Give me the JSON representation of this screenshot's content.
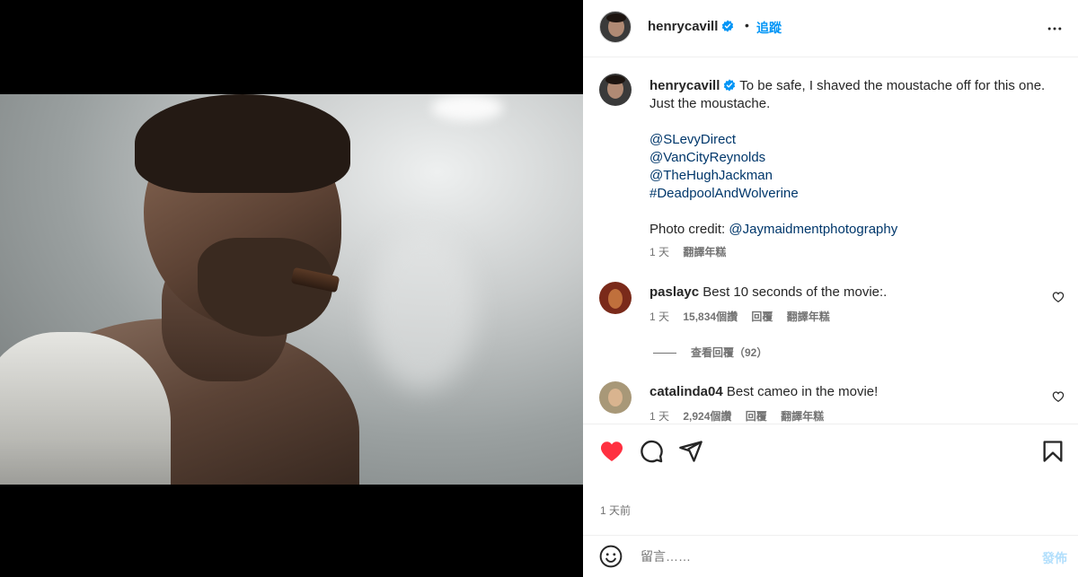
{
  "post": {
    "media": {
      "alt": "",
      "type": "photo"
    },
    "header": {
      "username": "henrycavill",
      "verified_icon": "verified-badge-icon",
      "separator": "•",
      "follow_label": "追蹤",
      "more_icon": "more-options-icon"
    },
    "caption": {
      "username": "henrycavill",
      "text": "To be safe, I shaved the moustache off for this one. Just the moustache.",
      "mentions": [
        "@SLevyDirect",
        "@VanCityReynolds",
        "@TheHughJackman",
        "#DeadpoolAndWolverine"
      ],
      "credit_prefix": "Photo credit: ",
      "credit_link": "@Jaymaidmentphotography",
      "time": "1 天",
      "translate": "翻譯年糕"
    },
    "comments": [
      {
        "username": "paslayc",
        "text": "Best 10 seconds of the movie:.",
        "time": "1 天",
        "likes": "15,834個讚",
        "reply": "回覆",
        "translate": "翻譯年糕"
      },
      {
        "username": "catalinda04",
        "text": "Best cameo in the movie!",
        "time": "1 天",
        "likes": "2,924個讚",
        "reply": "回覆",
        "translate": "翻譯年糕"
      }
    ],
    "view_replies": "查看回覆（92）",
    "actions": {
      "like_icon": "heart-filled-icon",
      "comment_icon": "comment-icon",
      "share_icon": "share-icon",
      "save_icon": "bookmark-icon",
      "like_color": "#ff3040"
    },
    "timestamp": "1 天前",
    "add_comment": {
      "emoji_icon": "emoji-icon",
      "placeholder": "留言……",
      "post_label": "發佈"
    }
  }
}
